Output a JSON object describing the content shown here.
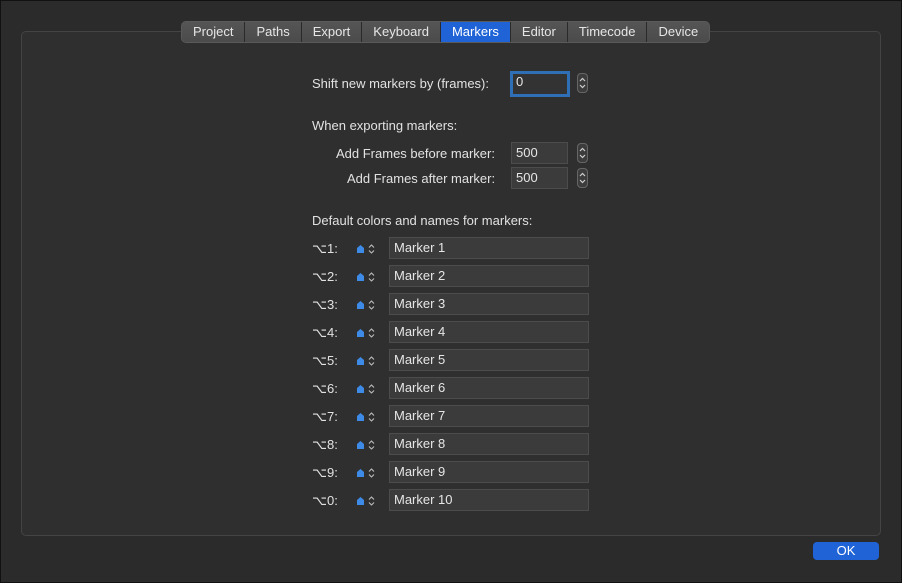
{
  "tabs": [
    {
      "label": "Project"
    },
    {
      "label": "Paths"
    },
    {
      "label": "Export"
    },
    {
      "label": "Keyboard"
    },
    {
      "label": "Markers",
      "active": true
    },
    {
      "label": "Editor"
    },
    {
      "label": "Timecode"
    },
    {
      "label": "Device"
    }
  ],
  "shift": {
    "label": "Shift new markers by (frames):",
    "value": "0"
  },
  "exporting": {
    "heading": "When exporting markers:",
    "before_label": "Add Frames before marker:",
    "before_value": "500",
    "after_label": "Add Frames after marker:",
    "after_value": "500"
  },
  "defaults": {
    "heading": "Default colors and names for markers:",
    "swatch_color": "#3d8be6",
    "markers": [
      {
        "shortcut": "⌥1:",
        "name": "Marker 1"
      },
      {
        "shortcut": "⌥2:",
        "name": "Marker 2"
      },
      {
        "shortcut": "⌥3:",
        "name": "Marker 3"
      },
      {
        "shortcut": "⌥4:",
        "name": "Marker 4"
      },
      {
        "shortcut": "⌥5:",
        "name": "Marker 5"
      },
      {
        "shortcut": "⌥6:",
        "name": "Marker 6"
      },
      {
        "shortcut": "⌥7:",
        "name": "Marker 7"
      },
      {
        "shortcut": "⌥8:",
        "name": "Marker 8"
      },
      {
        "shortcut": "⌥9:",
        "name": "Marker 9"
      },
      {
        "shortcut": "⌥0:",
        "name": "Marker 10"
      }
    ]
  },
  "ok_label": "OK",
  "accent": "#1f63d6"
}
